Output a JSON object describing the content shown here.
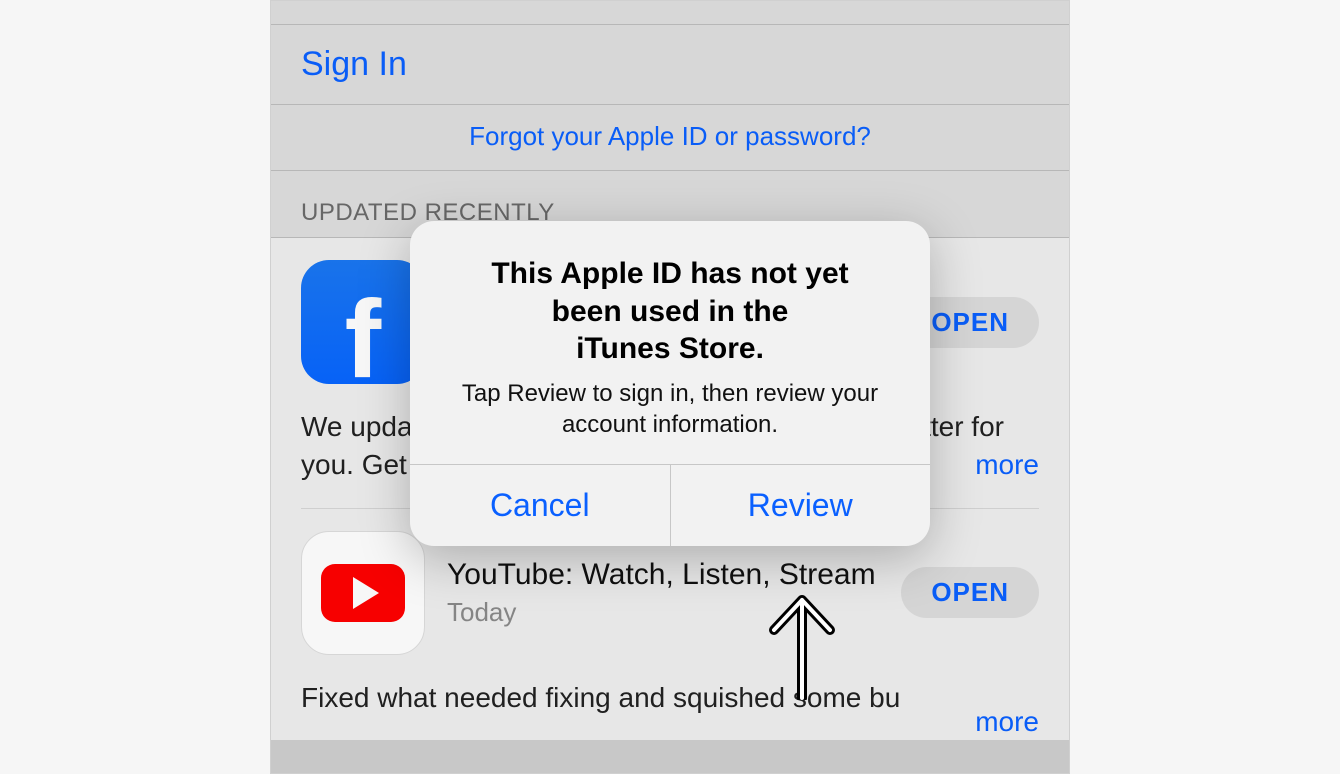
{
  "signin": {
    "label": "Sign In"
  },
  "forgot": {
    "label": "Forgot your Apple ID or password?"
  },
  "section": {
    "header": "UPDATED RECENTLY"
  },
  "apps": [
    {
      "name": "Facebook",
      "subtitle": "",
      "action": "OPEN",
      "desc_visible": "We update the app regularly so we can make it better for you. Get the latest version for all of the a",
      "more": "more"
    },
    {
      "name": "YouTube: Watch, Listen, Stream",
      "subtitle": "Today",
      "action": "OPEN",
      "desc_visible": "Fixed what needed fixing and squished some bu",
      "more": "more"
    }
  ],
  "alert": {
    "title": "This Apple ID has not yet\nbeen used in the\niTunes Store.",
    "message": "Tap Review to sign in, then review your account information.",
    "cancel": "Cancel",
    "confirm": "Review"
  }
}
